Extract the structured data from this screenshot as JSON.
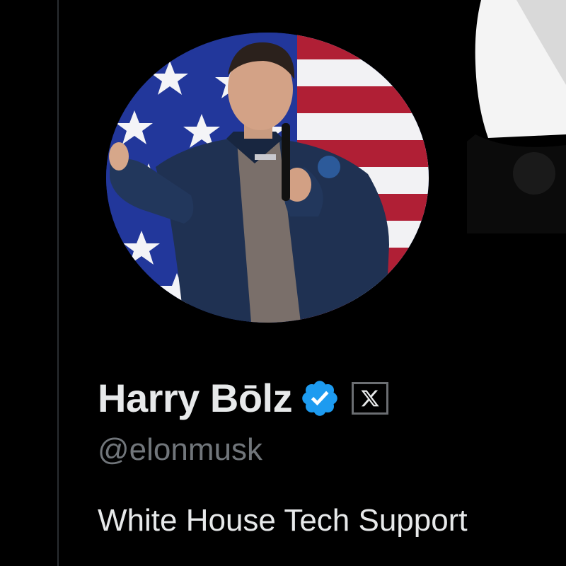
{
  "profile": {
    "display_name": "Harry Bōlz",
    "handle": "@elonmusk",
    "bio": "White House Tech Support"
  },
  "icons": {
    "verified": "verified-checkmark-icon",
    "affiliate": "x-logo-icon"
  },
  "colors": {
    "background": "#000000",
    "name_text": "#e7e9ea",
    "handle_text": "#71767b",
    "verified_blue": "#1d9bf0",
    "divider": "#2a2d31"
  }
}
